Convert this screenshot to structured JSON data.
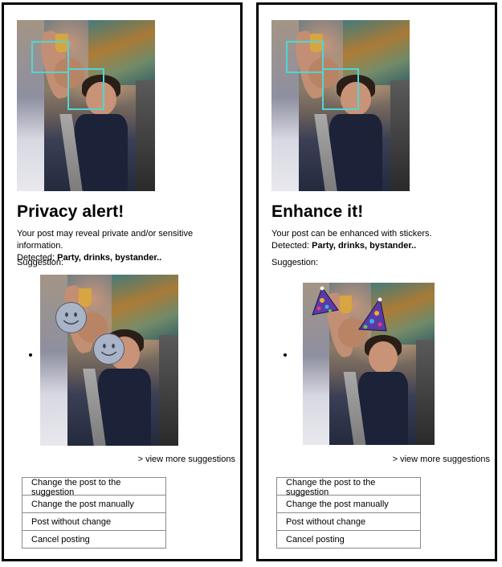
{
  "panels": [
    {
      "id": "privacy",
      "title": "Privacy alert!",
      "description": "Your post may reveal private and/or sensitive information.",
      "detected_label": "Detected: ",
      "detected_value": "Party, drinks, bystander..",
      "suggestion_label": "Suggestion:",
      "suggestion_kind": "faces covered with smiley stickers",
      "more_link": "> view more suggestions",
      "actions": [
        "Change the post to the suggestion",
        "Change the post manually",
        "Post without change",
        "Cancel posting"
      ]
    },
    {
      "id": "enhance",
      "title": "Enhance it!",
      "description": "Your post can be enhanced with stickers.",
      "detected_label": "Detected: ",
      "detected_value": "Party, drinks, bystander..",
      "suggestion_label": "Suggestion:",
      "suggestion_kind": "party hat stickers",
      "more_link": "> view more suggestions",
      "actions": [
        "Change the post to the suggestion",
        "Change the post manually",
        "Post without change",
        "Cancel posting"
      ]
    }
  ],
  "colors": {
    "face_box": "#4fd6d6",
    "smiley_fill": "#aab4c8",
    "hat_purple": "#5a3aa8",
    "panel_border": "#000000"
  },
  "icons": {
    "sticker_privacy": "smiley-face-icon",
    "sticker_enhance": "party-hat-icon"
  }
}
